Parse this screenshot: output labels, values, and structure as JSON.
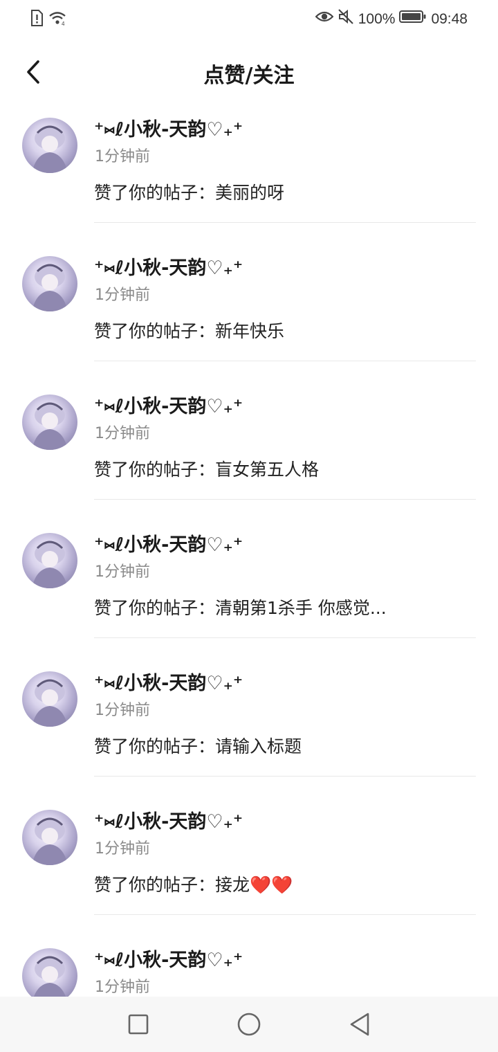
{
  "status_bar": {
    "battery": "100%",
    "time": "09:48"
  },
  "header": {
    "title": "点赞/关注"
  },
  "notifications": [
    {
      "username": "⁺⑅ℓ小秋-天韵♡₊⁺",
      "time": "1分钟前",
      "action": "赞了你的帖子：美丽的呀"
    },
    {
      "username": "⁺⑅ℓ小秋-天韵♡₊⁺",
      "time": "1分钟前",
      "action": "赞了你的帖子：新年快乐"
    },
    {
      "username": "⁺⑅ℓ小秋-天韵♡₊⁺",
      "time": "1分钟前",
      "action": "赞了你的帖子：盲女第五人格"
    },
    {
      "username": "⁺⑅ℓ小秋-天韵♡₊⁺",
      "time": "1分钟前",
      "action": "赞了你的帖子：清朝第1杀手 你感觉..."
    },
    {
      "username": "⁺⑅ℓ小秋-天韵♡₊⁺",
      "time": "1分钟前",
      "action": "赞了你的帖子：请输入标题"
    },
    {
      "username": "⁺⑅ℓ小秋-天韵♡₊⁺",
      "time": "1分钟前",
      "action": "赞了你的帖子：接龙❤️❤️"
    },
    {
      "username": "⁺⑅ℓ小秋-天韵♡₊⁺",
      "time": "1分钟前",
      "action": ""
    }
  ],
  "icons": {
    "back": "chevron-left-icon",
    "nav_recent": "square-icon",
    "nav_home": "circle-icon",
    "nav_back": "triangle-back-icon"
  },
  "colors": {
    "text_primary": "#1a1a1a",
    "text_secondary": "#8a8a8a",
    "divider": "#e8e8e8",
    "nav_background": "#f7f7f7"
  }
}
